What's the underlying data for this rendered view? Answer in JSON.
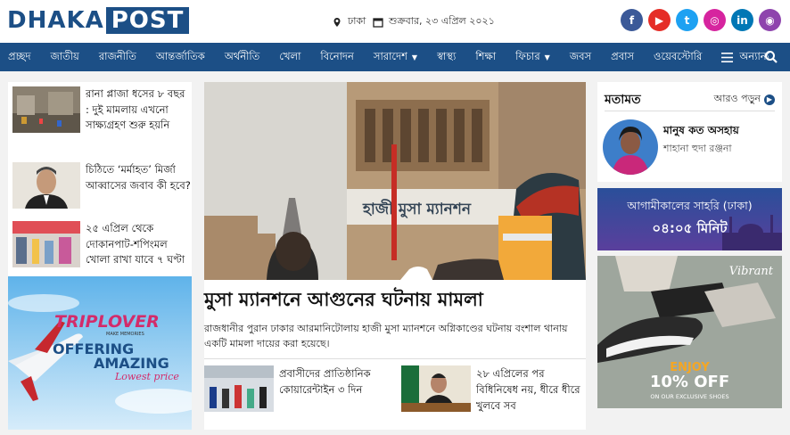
{
  "brand": {
    "logo_part1": "DHAKA",
    "logo_part2": "POST",
    "accent": "#1c4f86"
  },
  "header": {
    "location": "ঢাকা",
    "date": "শুক্রবার, ২৩ এপ্রিল ২০২১"
  },
  "socials": [
    {
      "icon": "facebook-icon",
      "glyph": "f",
      "color": "#3b5998"
    },
    {
      "icon": "youtube-icon",
      "glyph": "▶",
      "color": "#e52d27"
    },
    {
      "icon": "twitter-icon",
      "glyph": "t",
      "color": "#1da1f2"
    },
    {
      "icon": "instagram-icon",
      "glyph": "◎",
      "color": "#d6249f"
    },
    {
      "icon": "linkedin-icon",
      "glyph": "in",
      "color": "#0077b5"
    },
    {
      "icon": "podcast-icon",
      "glyph": "◉",
      "color": "#8e44ad"
    }
  ],
  "nav": {
    "items": [
      "প্রচ্ছদ",
      "জাতীয়",
      "রাজনীতি",
      "আন্তর্জাতিক",
      "অর্থনীতি",
      "খেলা",
      "বিনোদন",
      "সারাদেশ",
      "স্বাস্থ্য",
      "শিক্ষা",
      "ফিচার",
      "জবস",
      "প্রবাস",
      "ওয়েবস্টোরি"
    ],
    "more": "অন্যান্য"
  },
  "left_news": [
    {
      "title": "রানা প্লাজা ধসের ৮ বছর : দুই মামলায় এখনো সাক্ষ্যগ্রহণ শুরু হয়নি"
    },
    {
      "title": "চিঠিতে ‘মর্মাহত’ মির্জা আব্বাসের জবাব কী হবে?"
    },
    {
      "title": "২৫ এপ্রিল থেকে দোকানপাট-শপিংমল খোলা রাখা যাবে ৭ ঘণ্টা"
    }
  ],
  "ad_left": {
    "brand": "TRIPLOVER",
    "tagline": "MAKE MEMORIES",
    "line1": "OFFERING",
    "line2": "AMAZING",
    "line3": "Lowest price"
  },
  "lead": {
    "sign_text": "হাজী মুসা ম্যানশন",
    "headline": "মুসা ম্যানশনে আগুনের ঘটনায় মামলা",
    "summary": "রাজধানীর পুরান ঢাকার আরমানিটোলায় হাজী মুসা ম্যানশনে অগ্নিকাণ্ডের ঘটনায় বংশাল থানায় একটি মামলা দায়ের করা হয়েছে।"
  },
  "sub_news": [
    {
      "title": "প্রবাসীদের প্রাতিষ্ঠানিক কোয়ারেন্টাইন ৩ দিন"
    },
    {
      "title": "২৮ এপ্রিলের পর বিধিনিষেধ নয়, ধীরে ধীরে খুলবে সব"
    }
  ],
  "opinion": {
    "heading": "মতামত",
    "more": "আরও পড়ুন",
    "title": "মানুষ কত অসহায়",
    "author": "শাহানা হুদা রঞ্জনা"
  },
  "sehri": {
    "line1": "আগামীকালের সাহরি (ঢাকা)",
    "line2": "০৪:০৫ মিনিট"
  },
  "ad_right": {
    "brand": "Vibrant",
    "line1": "ENJOY",
    "line2": "10% OFF",
    "line3": "ON OUR EXCLUSIVE SHOES"
  }
}
